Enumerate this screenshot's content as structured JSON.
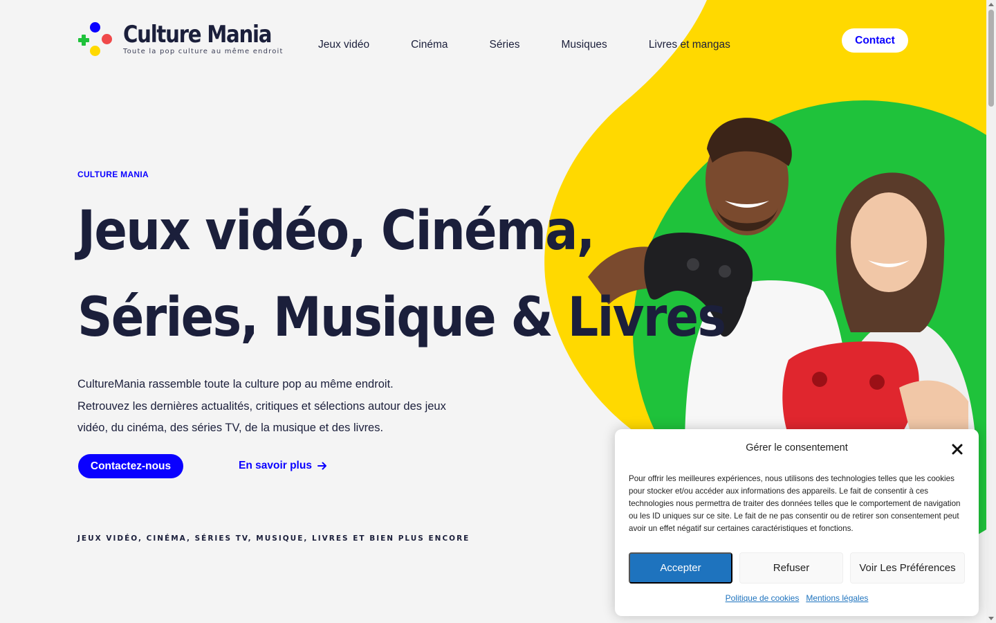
{
  "brand": {
    "name": "Culture Mania",
    "tagline": "Toute la pop culture au même endroit",
    "colors": {
      "blue": "#0a00ff",
      "red": "#f0494a",
      "yellow": "#ffd900",
      "green": "#1fc23b",
      "navy": "#1b1f3b"
    }
  },
  "nav": {
    "items": [
      {
        "label": "Jeux vidéo"
      },
      {
        "label": "Cinéma"
      },
      {
        "label": "Séries"
      },
      {
        "label": "Musiques"
      },
      {
        "label": "Livres et mangas"
      }
    ],
    "contact_label": "Contact"
  },
  "hero": {
    "eyebrow": "CULTURE MANIA",
    "title_line1": "Jeux vidéo, Cinéma,",
    "title_line2": "Séries, Musique & Livres",
    "description_line1": "CultureMania rassemble toute la culture pop au même endroit.",
    "description_line2": "Retrouvez les dernières actualités, critiques et sélections autour des jeux vidéo, du cinéma, des séries TV, de la musique et des livres.",
    "primary_button": "Contactez-nous",
    "secondary_link": "En savoir plus",
    "strip": "JEUX VIDÉO, CINÉMA, SÉRIES TV, MUSIQUE, LIVRES ET BIEN PLUS ENCORE",
    "image_subject": "two-gamers-holding-controllers"
  },
  "consent": {
    "title": "Gérer le consentement",
    "text": "Pour offrir les meilleures expériences, nous utilisons des technologies telles que les cookies pour stocker et/ou accéder aux informations des appareils. Le fait de consentir à ces technologies nous permettra de traiter des données telles que le comportement de navigation ou les ID uniques sur ce site. Le fait de ne pas consentir ou de retirer son consentement peut avoir un effet négatif sur certaines caractéristiques et fonctions.",
    "accept": "Accepter",
    "deny": "Refuser",
    "preferences": "Voir Les Préférences",
    "cookie_policy_link": "Politique de cookies",
    "legal_link": "Mentions légales"
  }
}
